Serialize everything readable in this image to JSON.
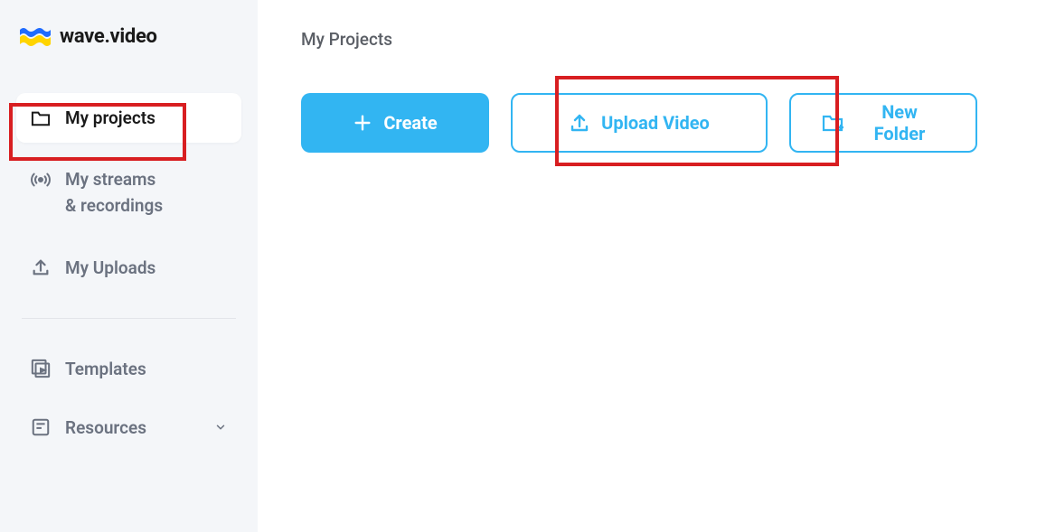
{
  "brand": {
    "name": "wave.video"
  },
  "sidebar": {
    "items": [
      {
        "label": "My projects"
      },
      {
        "label_line1": "My streams",
        "label_line2": "& recordings"
      },
      {
        "label": "My Uploads"
      },
      {
        "label": "Templates"
      },
      {
        "label": "Resources"
      }
    ]
  },
  "main": {
    "title": "My Projects",
    "buttons": {
      "create": "Create",
      "upload": "Upload Video",
      "new_folder": "New Folder"
    }
  }
}
